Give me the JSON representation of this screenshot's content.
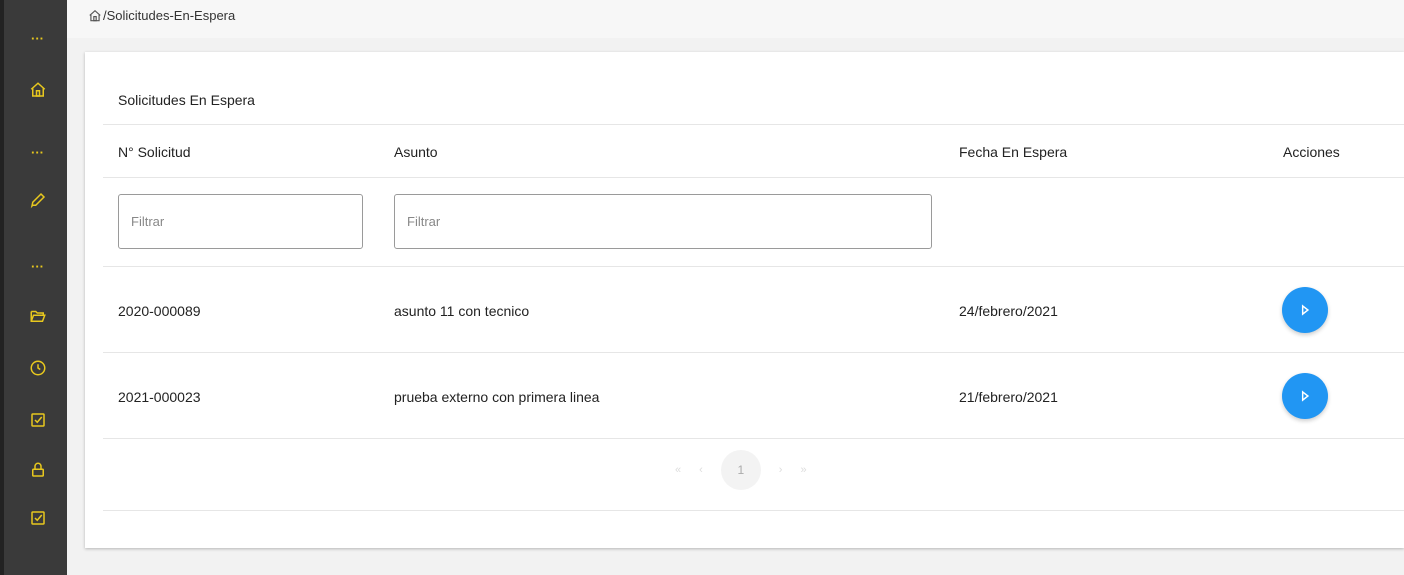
{
  "breadcrumb": {
    "path": "/Solicitudes-En-Espera"
  },
  "sidebar": {
    "items": [
      {
        "type": "dots",
        "icon": "more-dots-icon"
      },
      {
        "type": "icon",
        "icon": "home-icon"
      },
      {
        "type": "dots",
        "icon": "more-dots-icon"
      },
      {
        "type": "icon",
        "icon": "pencil-icon"
      },
      {
        "type": "dots",
        "icon": "more-dots-icon"
      },
      {
        "type": "icon",
        "icon": "folder-open-icon"
      },
      {
        "type": "icon",
        "icon": "clock-icon"
      },
      {
        "type": "icon",
        "icon": "checkbox-icon"
      },
      {
        "type": "icon",
        "icon": "lock-icon"
      },
      {
        "type": "icon",
        "icon": "checkbox-icon"
      }
    ]
  },
  "card": {
    "title": "Solicitudes En Espera",
    "columns": {
      "numero": "N° Solicitud",
      "asunto": "Asunto",
      "fecha": "Fecha En Espera",
      "acciones": "Acciones"
    },
    "filters": {
      "numero_placeholder": "Filtrar",
      "asunto_placeholder": "Filtrar"
    },
    "rows": [
      {
        "numero": "2020-000089",
        "asunto": "asunto 11 con tecnico",
        "fecha": "24/febrero/2021"
      },
      {
        "numero": "2021-000023",
        "asunto": "prueba externo con primera linea",
        "fecha": "21/febrero/2021"
      }
    ],
    "pagination": {
      "first": "«",
      "prev": "‹",
      "current": "1",
      "next": "›",
      "last": "»"
    }
  },
  "colors": {
    "sidebar_bg": "#3a3a3a",
    "sidebar_icon": "#e8c81e",
    "action_button": "#2196f3"
  }
}
